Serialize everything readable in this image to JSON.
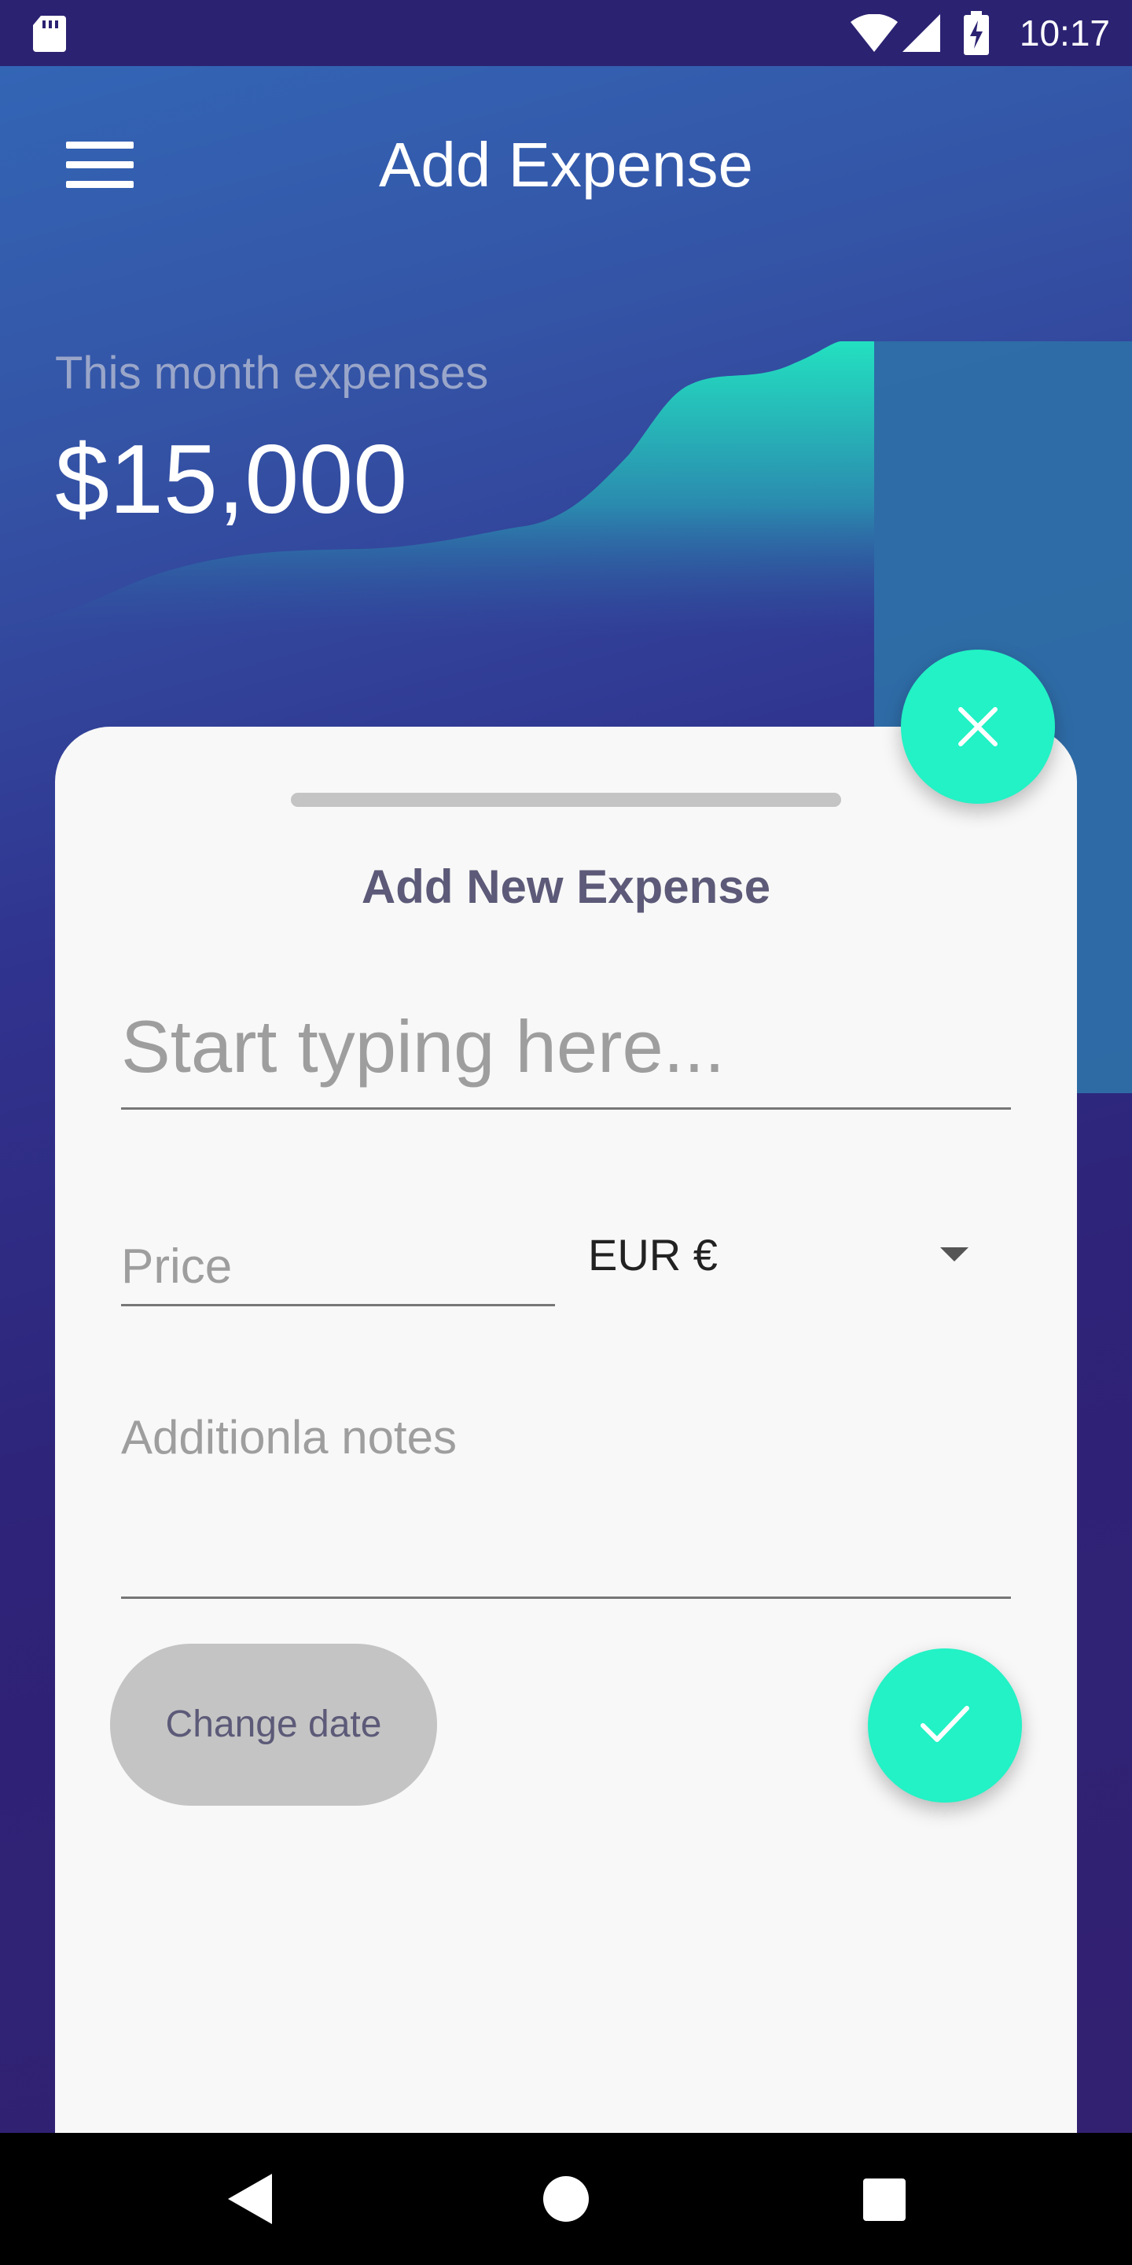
{
  "status_bar": {
    "time": "10:17",
    "icons": [
      "sd-card-icon",
      "wifi-icon",
      "cell-signal-icon",
      "battery-charging-icon"
    ]
  },
  "app_bar": {
    "title": "Add Expense",
    "menu_icon": "hamburger-menu-icon"
  },
  "summary": {
    "label": "This month expenses",
    "amount": "$15,000"
  },
  "sheet": {
    "title": "Add New Expense",
    "search_placeholder": "Start typing here...",
    "price_placeholder": "Price",
    "currency_selected": "EUR €",
    "notes_placeholder": "Additionla notes",
    "change_date_label": "Change date",
    "close_icon": "close-icon",
    "confirm_icon": "check-icon"
  },
  "nav_bar": {
    "icons": [
      "back-icon",
      "home-icon",
      "recents-icon"
    ]
  },
  "colors": {
    "accent": "#22f2c5",
    "sheet_bg": "#f8f8f8",
    "title_text": "#5c5a78",
    "status_bar": "#2b2272"
  }
}
